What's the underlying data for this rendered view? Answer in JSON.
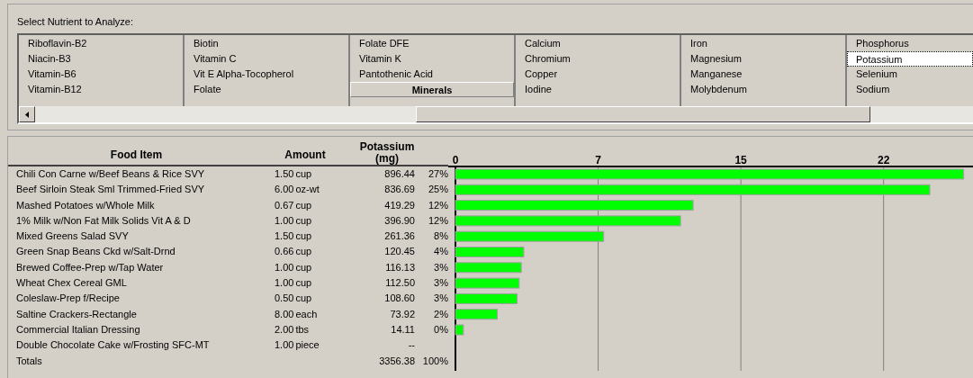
{
  "nutrient_panel": {
    "label": "Select Nutrient to Analyze:",
    "nutrients": [
      {
        "label": "Riboflavin-B2",
        "kind": "item",
        "selected": false
      },
      {
        "label": "Niacin-B3",
        "kind": "item",
        "selected": false
      },
      {
        "label": "Vitamin-B6",
        "kind": "item",
        "selected": false
      },
      {
        "label": "Vitamin-B12",
        "kind": "item",
        "selected": false
      },
      {
        "label": "Biotin",
        "kind": "item",
        "selected": false
      },
      {
        "label": "Vitamin C",
        "kind": "item",
        "selected": false
      },
      {
        "label": "Vit E Alpha-Tocopherol",
        "kind": "item",
        "selected": false
      },
      {
        "label": "Folate",
        "kind": "item",
        "selected": false
      },
      {
        "label": "Folate DFE",
        "kind": "item",
        "selected": false
      },
      {
        "label": "Vitamin K",
        "kind": "item",
        "selected": false
      },
      {
        "label": "Pantothenic Acid",
        "kind": "item",
        "selected": false
      },
      {
        "label": "Minerals",
        "kind": "header",
        "selected": false
      },
      {
        "label": "Calcium",
        "kind": "item",
        "selected": false
      },
      {
        "label": "Chromium",
        "kind": "item",
        "selected": false
      },
      {
        "label": "Copper",
        "kind": "item",
        "selected": false
      },
      {
        "label": "Iodine",
        "kind": "item",
        "selected": false
      },
      {
        "label": "Iron",
        "kind": "item",
        "selected": false
      },
      {
        "label": "Magnesium",
        "kind": "item",
        "selected": false
      },
      {
        "label": "Manganese",
        "kind": "item",
        "selected": false
      },
      {
        "label": "Molybdenum",
        "kind": "item",
        "selected": false
      },
      {
        "label": "Phosphorus",
        "kind": "item",
        "selected": false
      },
      {
        "label": "Potassium",
        "kind": "item",
        "selected": true
      },
      {
        "label": "Selenium",
        "kind": "item",
        "selected": false
      },
      {
        "label": "Sodium",
        "kind": "item",
        "selected": false
      }
    ]
  },
  "table": {
    "columns": [
      {
        "label": "Food Item"
      },
      {
        "label": "Amount"
      },
      {
        "label": "Potassium",
        "unit": "(mg)"
      }
    ],
    "rows": [
      {
        "food": "Chili Con Carne w/Beef Beans & Rice SVY",
        "amount": "1.50",
        "unit": "cup",
        "value": "896.44",
        "percent": "27%"
      },
      {
        "food": "Beef Sirloin Steak Sml Trimmed-Fried SVY",
        "amount": "6.00",
        "unit": "oz-wt",
        "value": "836.69",
        "percent": "25%"
      },
      {
        "food": "Mashed Potatoes w/Whole Milk",
        "amount": "0.67",
        "unit": "cup",
        "value": "419.29",
        "percent": "12%"
      },
      {
        "food": "1% Milk w/Non Fat Milk Solids Vit A & D",
        "amount": "1.00",
        "unit": "cup",
        "value": "396.90",
        "percent": "12%"
      },
      {
        "food": "Mixed Greens Salad SVY",
        "amount": "1.50",
        "unit": "cup",
        "value": "261.36",
        "percent": "8%"
      },
      {
        "food": "Green Snap Beans Ckd w/Salt-Drnd",
        "amount": "0.66",
        "unit": "cup",
        "value": "120.45",
        "percent": "4%"
      },
      {
        "food": "Brewed Coffee-Prep w/Tap Water",
        "amount": "1.00",
        "unit": "cup",
        "value": "116.13",
        "percent": "3%"
      },
      {
        "food": "Wheat Chex Cereal GML",
        "amount": "1.00",
        "unit": "cup",
        "value": "112.50",
        "percent": "3%"
      },
      {
        "food": "Coleslaw-Prep f/Recipe",
        "amount": "0.50",
        "unit": "cup",
        "value": "108.60",
        "percent": "3%"
      },
      {
        "food": "Saltine Crackers-Rectangle",
        "amount": "8.00",
        "unit": "each",
        "value": "73.92",
        "percent": "2%"
      },
      {
        "food": "Commercial Italian Dressing",
        "amount": "2.00",
        "unit": "tbs",
        "value": "14.11",
        "percent": "0%"
      },
      {
        "food": "Double Chocolate Cake w/Frosting SFC-MT",
        "amount": "1.00",
        "unit": "piece",
        "value": "--"
      }
    ],
    "totals": {
      "label": "Totals",
      "value": "3356.38",
      "percent": "100%"
    },
    "chart_data": {
      "type": "bar",
      "orientation": "horizontal",
      "grid": true,
      "series": [
        {
          "color": "#00ff00",
          "values": [
            26.71,
            24.93,
            12.49,
            11.83,
            7.79,
            3.59,
            3.46,
            3.35,
            3.24,
            2.2,
            0.42,
            null,
            null
          ]
        }
      ],
      "xlim": [
        0,
        27.2
      ],
      "xticks": [
        0,
        {
          "value": 7.5,
          "label": "7"
        },
        {
          "value": 15,
          "label": "15"
        },
        {
          "value": 22.5,
          "label": "22"
        }
      ]
    }
  }
}
